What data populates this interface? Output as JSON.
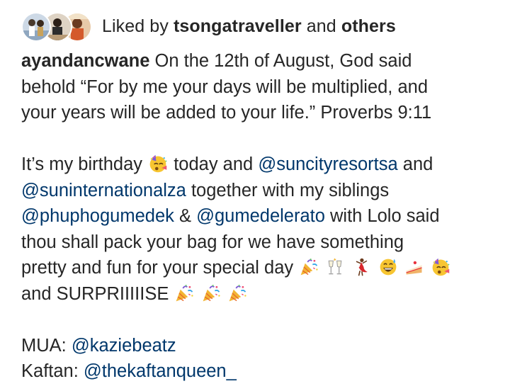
{
  "likes": {
    "prefix": "Liked by",
    "user": "tsongatraveller",
    "connector": "and",
    "others": "others"
  },
  "caption": {
    "username": "ayandancwane",
    "line1": "On the 12th of August, God said",
    "line2": "behold “For by me your days will be multiplied, and",
    "line3": "your years will be added to your life.” Proverbs 9:11",
    "p2_a": "It’s my birthday",
    "p2_b": "today and",
    "mention_suncity": "@suncityresortsa",
    "p2_c": "and",
    "mention_suninternational": "@suninternationalza",
    "p2_d": "together with my siblings",
    "mention_phupho": "@phuphogumedek",
    "p2_e": "&",
    "mention_lerato": "@gumedelerato",
    "p2_f": "with Lolo said",
    "p2_g": "thou  shall pack your bag for we have something",
    "p2_h": "pretty and fun for your special day",
    "p2_i": "and SURPRIIIIISE",
    "mua_label": "MUA:",
    "mention_mua": "@kaziebeatz",
    "kaftan_label": "Kaftan:",
    "mention_kaftan": "@thekaftanqueen_"
  },
  "icons": {
    "party_face": "partying-face-emoji",
    "party_popper": "party-popper-emoji",
    "champagne": "clinking-glasses-emoji",
    "dancer": "dancer-emoji",
    "sweat_smile": "grinning-sweat-emoji",
    "cake": "cake-slice-emoji"
  },
  "colors": {
    "text": "#262626",
    "mention": "#00376b",
    "background": "#ffffff"
  }
}
